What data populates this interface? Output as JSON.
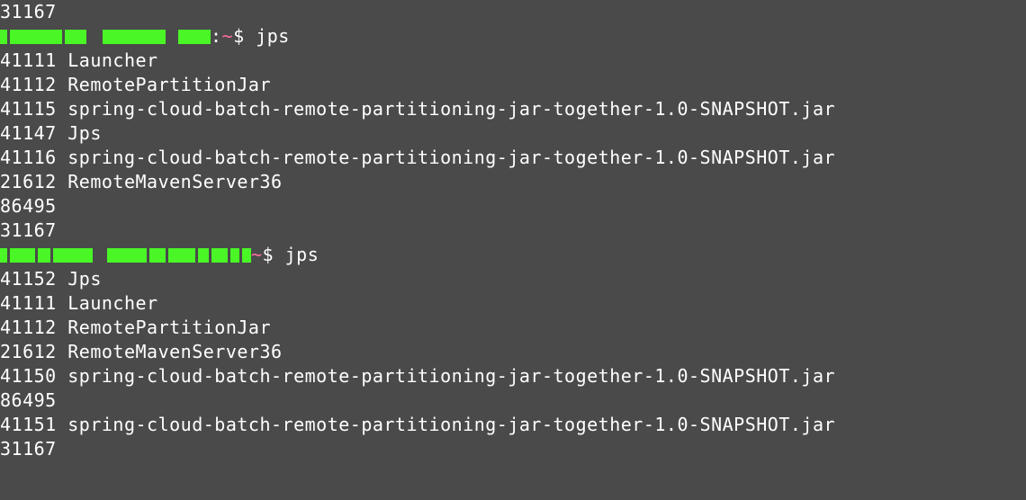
{
  "partial_top": "31167",
  "prompt1": {
    "colon": ":",
    "tilde": "~",
    "dollar": "$",
    "command": "jps"
  },
  "output1": [
    "41111 Launcher",
    "41112 RemotePartitionJar",
    "41115 spring-cloud-batch-remote-partitioning-jar-together-1.0-SNAPSHOT.jar",
    "41147 Jps",
    "41116 spring-cloud-batch-remote-partitioning-jar-together-1.0-SNAPSHOT.jar",
    "21612 RemoteMavenServer36",
    "86495",
    "31167"
  ],
  "prompt2": {
    "tilde": "~",
    "dollar": "$",
    "command": "jps"
  },
  "output2": [
    "41152 Jps",
    "41111 Launcher",
    "41112 RemotePartitionJar",
    "21612 RemoteMavenServer36",
    "41150 spring-cloud-batch-remote-partitioning-jar-together-1.0-SNAPSHOT.jar",
    "86495",
    "41151 spring-cloud-batch-remote-partitioning-jar-together-1.0-SNAPSHOT.jar",
    "31167"
  ]
}
